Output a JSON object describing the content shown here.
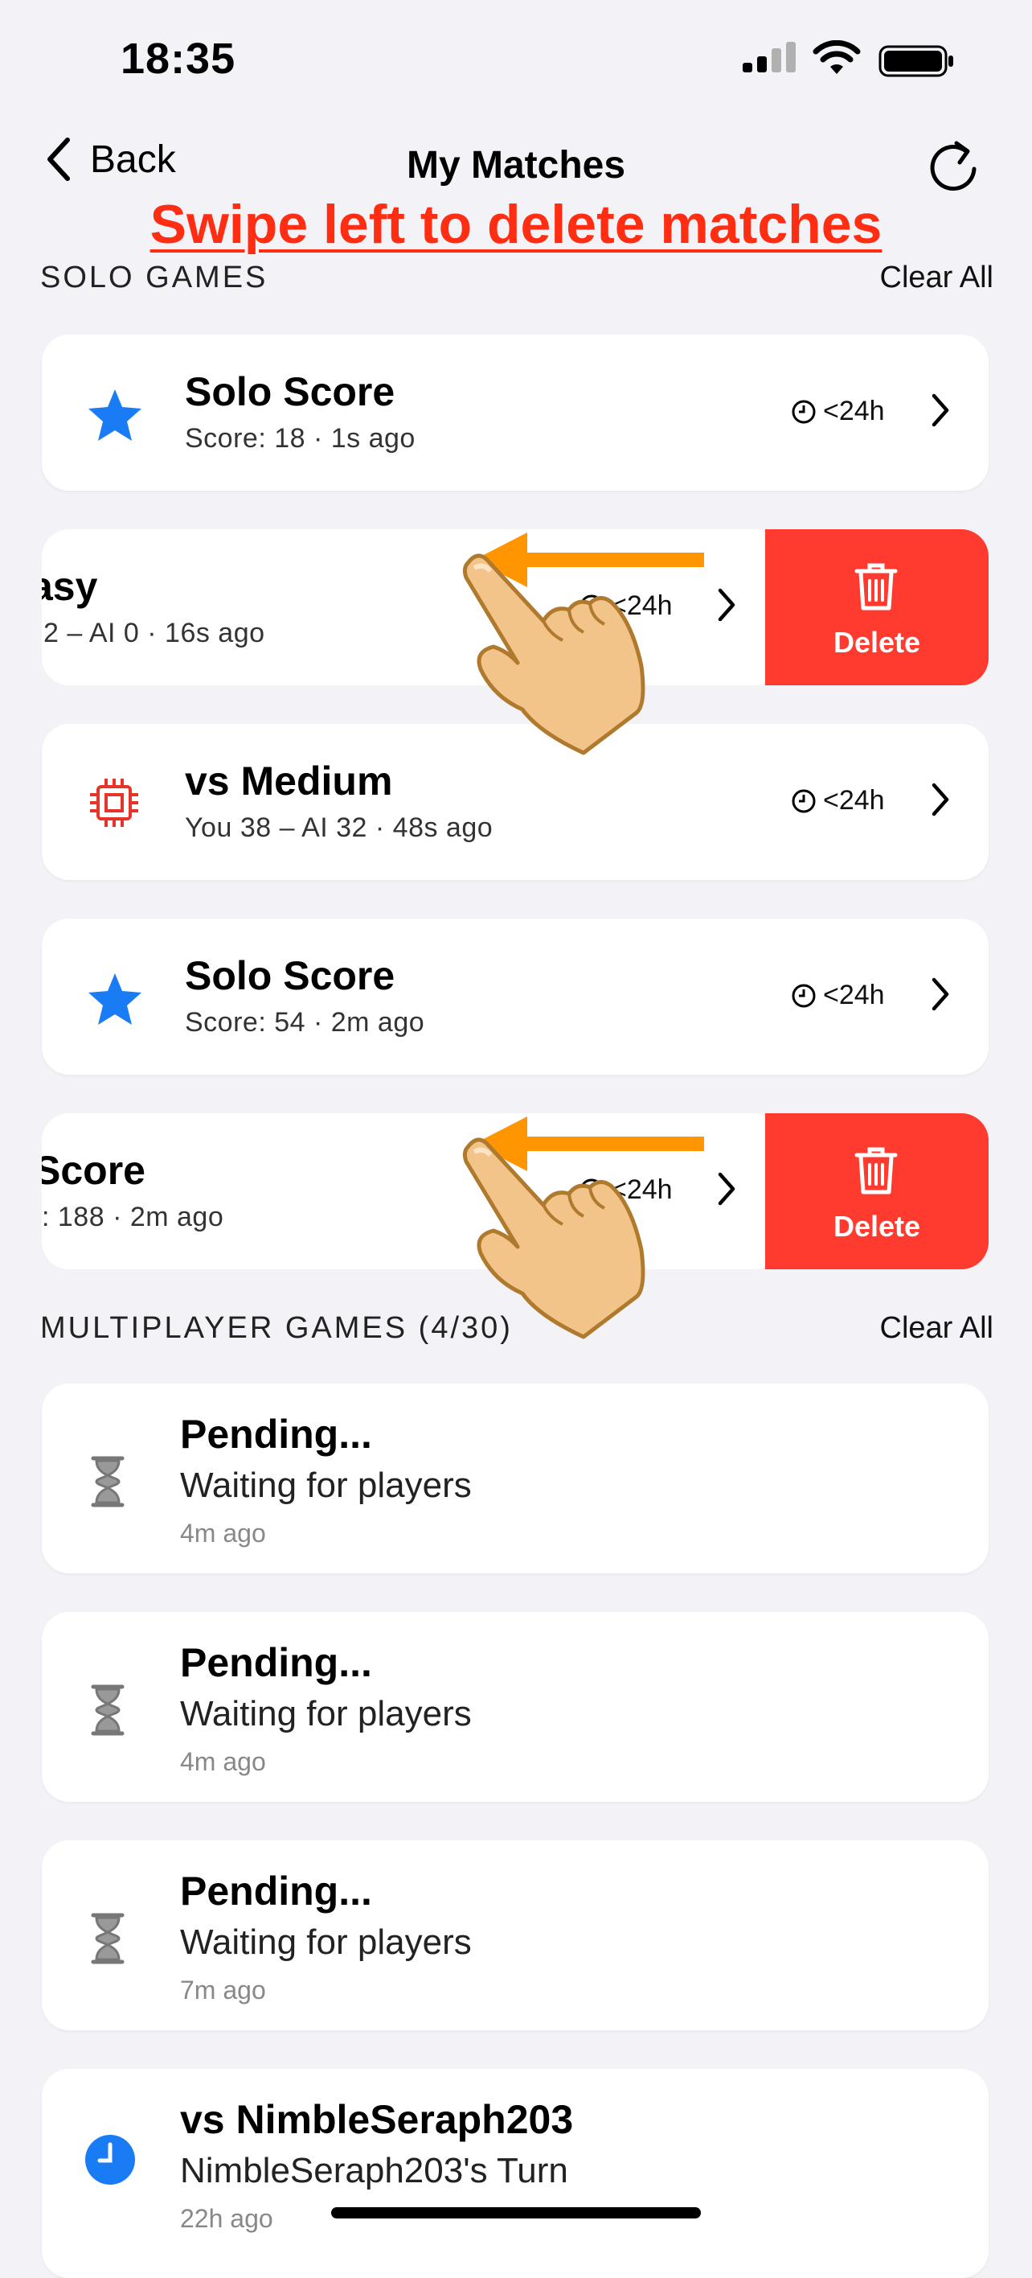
{
  "status_bar": {
    "time": "18:35"
  },
  "nav": {
    "back_label": "Back",
    "title": "My Matches"
  },
  "hint": "Swipe left to delete matches",
  "solo_section": {
    "title": "SOLO GAMES",
    "clear_all": "Clear All",
    "rows": [
      {
        "icon": "star-icon",
        "title": "Solo Score",
        "subtitle": "Score: 18 · 1s ago",
        "meta": "<24h"
      },
      {
        "icon": "chip-icon",
        "title": "asy",
        "subtitle": "2 – AI 0 · 16s ago",
        "meta": "<24h",
        "swiped": true,
        "delete_label": "Delete"
      },
      {
        "icon": "chip-icon",
        "title": "vs Medium",
        "subtitle": "You 38 – AI 32 · 48s ago",
        "meta": "<24h"
      },
      {
        "icon": "star-icon",
        "title": "Solo Score",
        "subtitle": "Score: 54 · 2m ago",
        "meta": "<24h"
      },
      {
        "icon": "star-icon",
        "title": "Score",
        "subtitle": ": 188 · 2m ago",
        "meta": "<24h",
        "swiped": true,
        "delete_label": "Delete"
      }
    ]
  },
  "multi_section": {
    "title": "MULTIPLAYER GAMES (4/30)",
    "clear_all": "Clear All",
    "rows": [
      {
        "icon": "hourglass-icon",
        "title": "Pending...",
        "subtitle": "Waiting for players",
        "time": "4m ago"
      },
      {
        "icon": "hourglass-icon",
        "title": "Pending...",
        "subtitle": "Waiting for players",
        "time": "4m ago"
      },
      {
        "icon": "hourglass-icon",
        "title": "Pending...",
        "subtitle": "Waiting for players",
        "time": "7m ago"
      },
      {
        "icon": "clock-icon",
        "title": "vs NimbleSeraph203",
        "subtitle": "NimbleSeraph203's Turn",
        "time": "22h ago"
      }
    ]
  },
  "colors": {
    "accent_blue": "#1A7CF5",
    "chip_red": "#E5352B",
    "delete_red": "#FF3B30",
    "hint_red": "#FF2D12",
    "arrow_orange": "#FF9500"
  }
}
